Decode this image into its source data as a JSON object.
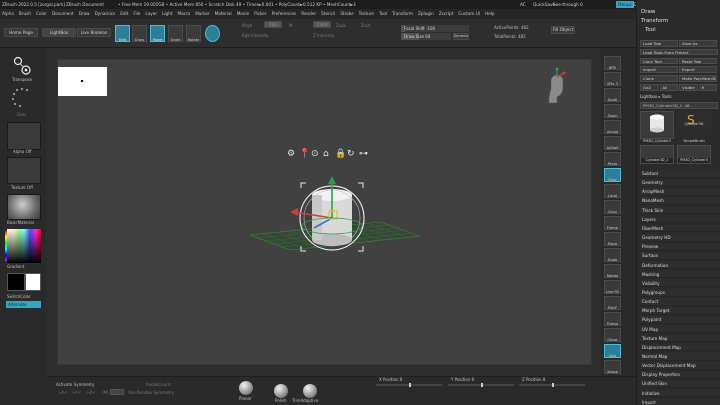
{
  "titlebar": {
    "app": "ZBrush 2022.0.5 [zorgol.park]",
    "doc": "ZBrush Document",
    "stats": "• Free Mem 19.001GB • Active Mem 850 • Scratch Disk 49 • Timer►0.001 • PolyCount►0.512 KP • MeshCount►1",
    "ac": "AC",
    "quicksave": "QuickSave",
    "seethrough": "See-through 0",
    "menus_btn": "Menus",
    "script": "DefaultZScript"
  },
  "menubar": [
    "Alpha",
    "Brush",
    "Color",
    "Document",
    "Draw",
    "Dynamics",
    "Edit",
    "File",
    "Layer",
    "Light",
    "Macro",
    "Marker",
    "Material",
    "Movie",
    "Picker",
    "Preferences",
    "Render",
    "Stencil",
    "Stroke",
    "Texture",
    "Tool",
    "Transform",
    "Zplugin",
    "Zscript",
    "Custom UI",
    "Help"
  ],
  "shelf": {
    "home_page": "Home Page",
    "lightbox": "LightBox",
    "live_boolean": "Live Boolean",
    "edit": "Edit",
    "draw": "Draw",
    "move": "Move",
    "scale": "Scale",
    "rotate": "Rotate",
    "mrgb": "Mrgb",
    "rgb": "Rgb",
    "m": "M",
    "zadd": "Zadd",
    "zsub": "Zsub",
    "zcut": "Zcut",
    "rgb_intensity": "Rgb Intensity",
    "z_intensity": "Z Intensity",
    "focal_shift": "Focal Shift -100",
    "draw_size": "Draw Size 64",
    "dynamic": "Dynamic",
    "active_points": "ActivePoints: 482",
    "total_points": "TotalPoints: 482",
    "fill_object": "Fill Object"
  },
  "left": {
    "transpose": "Transpose",
    "dots": "Dots",
    "alpha_off": "Alpha Off",
    "texture_off": "Texture Off",
    "material": "BasicMaterial",
    "gradient": "Gradient",
    "switch_color": "SwitchColor",
    "alternate": "Alternate"
  },
  "canvas": {
    "gizmo_icons": [
      "gear",
      "pin",
      "home",
      "lock",
      "refresh",
      "link"
    ]
  },
  "right_tools": [
    "BPR",
    "SPix 3",
    "Scroll",
    "Zoom",
    "Actual",
    "AAHalf",
    "Persp",
    "Floor",
    "Local",
    "Gxyz",
    "Frame",
    "Move",
    "Scale",
    "Rotate",
    "Line Fill",
    "PolyF",
    "Transp",
    "Ghost",
    "Solo",
    "Xpose"
  ],
  "tray": {
    "draw": "Draw",
    "transform": "Transform",
    "tool": "Tool",
    "buttons": [
      [
        "Load Tool",
        "Save As"
      ],
      [
        "Load Tools From Project",
        ""
      ],
      [
        "Copy Tool",
        "Paste Tool"
      ],
      [
        "Import",
        "Export"
      ],
      [
        "Clone",
        "Make PolyMesh3D"
      ],
      [
        "GoZ",
        "All",
        "Visible",
        "R"
      ]
    ],
    "lightbox_tools": "Lightbox ▸ Tools",
    "current_tool": "PM3D_Cylinder3D_1. 48",
    "thumbs": [
      "Cylinder3D",
      "PM3D_Cylinder3",
      "SimpleBrush",
      "Cylinder3D_1",
      "PM3D_Cylinder3"
    ],
    "subpalettes": [
      "Subtool",
      "Geometry",
      "ArrayMesh",
      "NanoMesh",
      "Thick Skin",
      "Layers",
      "FiberMesh",
      "Geometry HD",
      "Preview",
      "Surface",
      "Deformation",
      "Masking",
      "Visibility",
      "Polygroups",
      "Contact",
      "Morph Target",
      "Polypaint",
      "UV Map",
      "Texture Map",
      "Displacement Map",
      "Normal Map",
      "Vector Displacement Map",
      "Display Properties",
      "Unified Skin",
      "Initialize",
      "Import"
    ]
  },
  "bottom": {
    "activate_symmetry": "Activate Symmetry",
    "x": ">X<",
    "y": ">Y<",
    "z": ">Z<",
    "m": "(M)",
    "radial_count": "RadialCount",
    "use_posable": "Use Posable Symmetry",
    "materials": [
      "Planar",
      "Polish",
      "TrimAdaptive"
    ],
    "x_position": "X Position 8",
    "y_position": "Y Position 8",
    "z_position": "Z Position 8"
  },
  "colors": {
    "accent": "#2fa8c8",
    "panel": "#2b2b2b",
    "canvas": "#414141"
  }
}
